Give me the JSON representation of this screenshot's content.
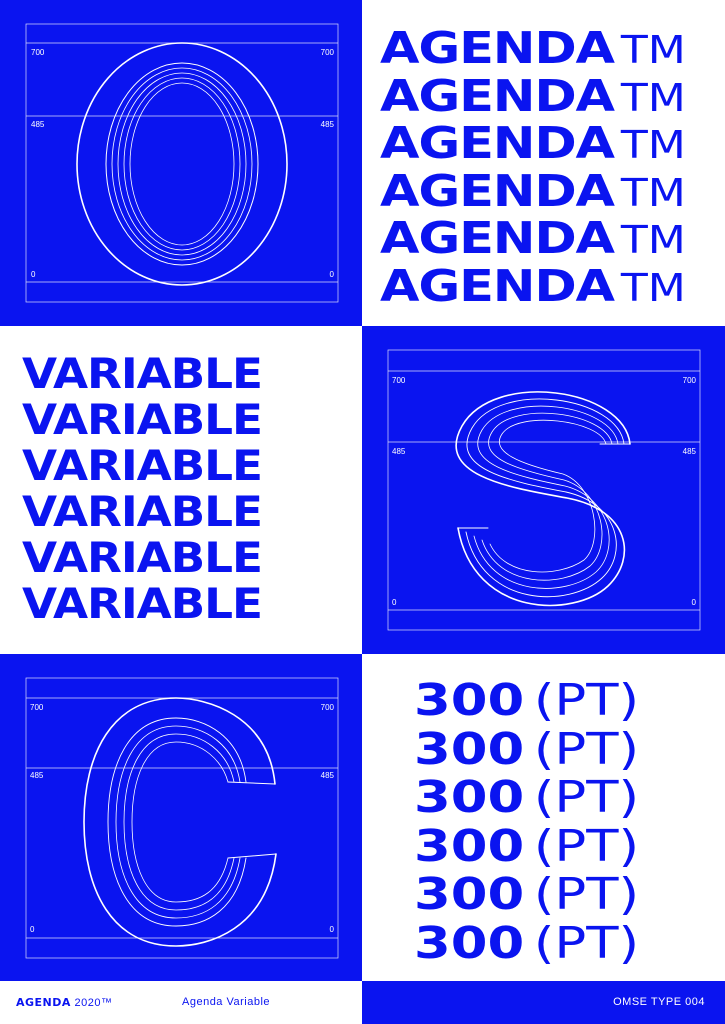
{
  "colors": {
    "blue": "#0a14f0",
    "white": "#ffffff"
  },
  "specimens": [
    {
      "glyph": "O",
      "labels": {
        "ascender": "700",
        "xheight": "485",
        "baseline": "0"
      }
    },
    {
      "glyph": "S",
      "labels": {
        "ascender": "700",
        "xheight": "485",
        "baseline": "0"
      }
    },
    {
      "glyph": "C",
      "labels": {
        "ascender": "700",
        "xheight": "485",
        "baseline": "0"
      }
    }
  ],
  "agenda_lines": [
    {
      "word": "AGENDA",
      "mark": "TM"
    },
    {
      "word": "AGENDA",
      "mark": "TM"
    },
    {
      "word": "AGENDA",
      "mark": "TM"
    },
    {
      "word": "AGENDA",
      "mark": "TM"
    },
    {
      "word": "AGENDA",
      "mark": "TM"
    },
    {
      "word": "AGENDA",
      "mark": "TM"
    }
  ],
  "variable_lines": [
    "VARIABLE",
    "VARIABLE",
    "VARIABLE",
    "VARIABLE",
    "VARIABLE",
    "VARIABLE"
  ],
  "size_lines": [
    {
      "num": "300",
      "unit": "(PT)"
    },
    {
      "num": "300",
      "unit": "(PT)"
    },
    {
      "num": "300",
      "unit": "(PT)"
    },
    {
      "num": "300",
      "unit": "(PT)"
    },
    {
      "num": "300",
      "unit": "(PT)"
    },
    {
      "num": "300",
      "unit": "(PT)"
    }
  ],
  "footer": {
    "brand_name": "AGENDA",
    "brand_year": "2020™",
    "product": "Agenda Variable",
    "series": "OMSE TYPE 004",
    "icon": "globe-icon"
  }
}
